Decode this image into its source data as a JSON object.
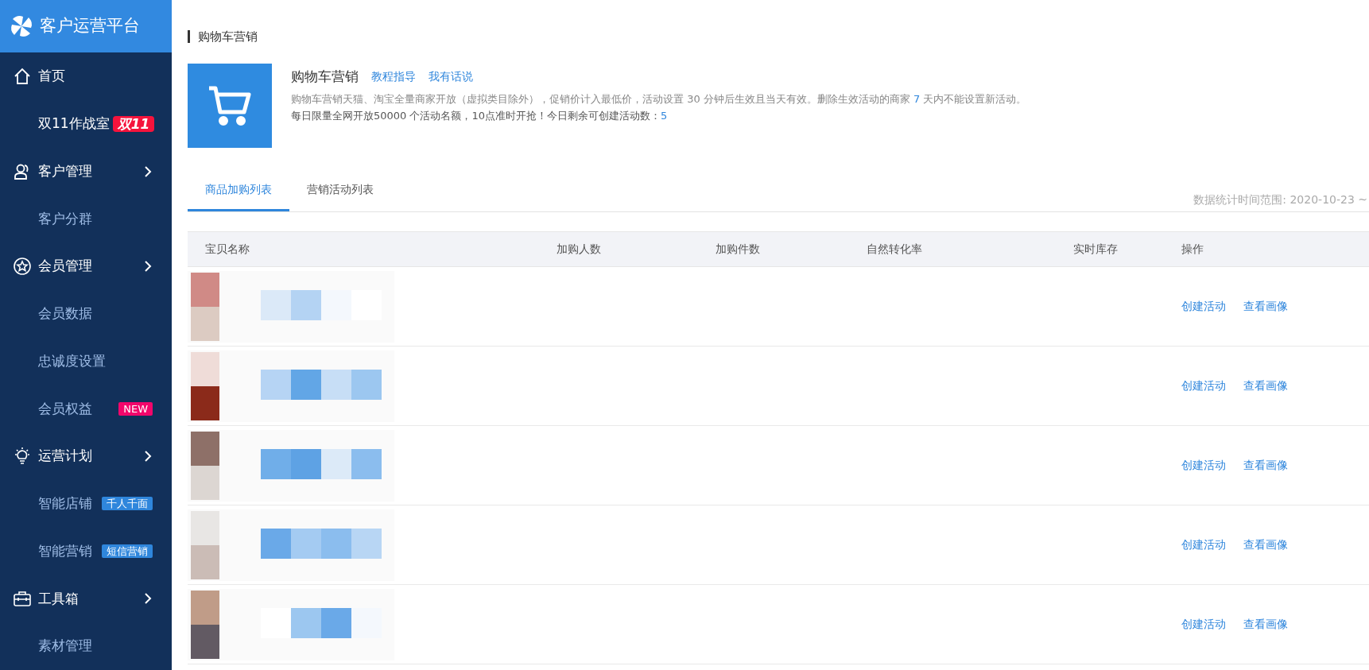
{
  "sidebar": {
    "brand": "客户运营平台",
    "items": [
      {
        "label": "首页",
        "kind": "link"
      },
      {
        "label": "双11作战室",
        "kind": "feature",
        "badge": {
          "text": "双11",
          "color": "#f5133c"
        }
      },
      {
        "label": "客户管理",
        "kind": "group"
      },
      {
        "label": "客户分群",
        "kind": "sub"
      },
      {
        "label": "会员管理",
        "kind": "group"
      },
      {
        "label": "会员数据",
        "kind": "sub"
      },
      {
        "label": "忠诚度设置",
        "kind": "sub"
      },
      {
        "label": "会员权益",
        "kind": "sub",
        "badge": {
          "text": "NEW",
          "color": "#f2066b"
        }
      },
      {
        "label": "运营计划",
        "kind": "group"
      },
      {
        "label": "智能店铺",
        "kind": "sub",
        "badge": {
          "text": "千人千面",
          "color": "#2f86dc"
        }
      },
      {
        "label": "智能营销",
        "kind": "sub",
        "badge": {
          "text": "短信营销",
          "color": "#2f86dc"
        }
      },
      {
        "label": "工具箱",
        "kind": "group"
      },
      {
        "label": "素材管理",
        "kind": "sub"
      }
    ]
  },
  "page_title": "购物车营销",
  "intro": {
    "title": "购物车营销",
    "links": [
      "教程指导",
      "我有话说"
    ],
    "description": [
      {
        "text": "购物车营销天猫、淘宝全量商家开放（虚拟类目除外），促销价计入最低价，活动设置 30 分钟后生效且当天有效。删除生效活动的商家 ",
        "highlight": false
      },
      {
        "text": "7",
        "highlight": true
      },
      {
        "text": " 天内不能设置新活动。",
        "highlight": false
      }
    ],
    "quota": [
      {
        "text": "每日限量全网开放50000 个活动名额，10点准时开抢！今日剩余可创建活动数：",
        "highlight": false
      },
      {
        "text": "5",
        "highlight": true
      }
    ]
  },
  "tabs": [
    {
      "label": "商品加购列表",
      "selected": true
    },
    {
      "label": "营销活动列表",
      "selected": false
    }
  ],
  "date_range": "数据统计时间范围: 2020-10-23 ~",
  "table": {
    "columns": [
      "宝贝名称",
      "加购人数",
      "加购件数",
      "自然转化率",
      "实时库存",
      "操作"
    ],
    "rows": [
      {
        "kind": "picture",
        "actions": [
          "创建活动",
          "查看画像"
        ]
      },
      {
        "kind": "picture",
        "actions": [
          "创建活动",
          "查看画像"
        ]
      },
      {
        "kind": "picture",
        "actions": [
          "创建活动",
          "查看画像"
        ]
      },
      {
        "kind": "picture",
        "actions": [
          "创建活动",
          "查看画像"
        ]
      },
      {
        "kind": "picture",
        "actions": [
          "创建活动",
          "查看画像"
        ]
      }
    ]
  }
}
